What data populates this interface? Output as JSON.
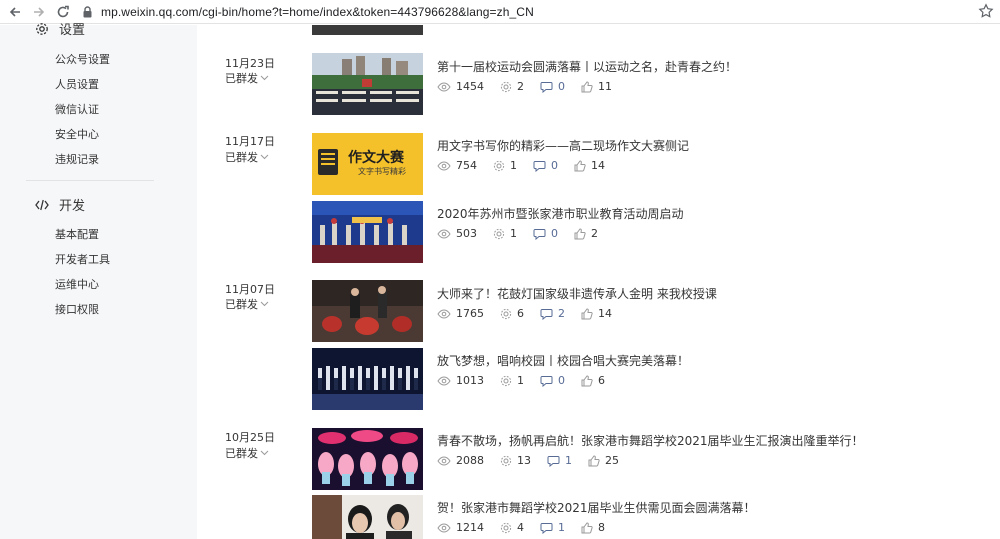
{
  "browser": {
    "url": "mp.weixin.qq.com/cgi-bin/home?t=home/index&token=443796628&lang=zh_CN"
  },
  "sidebar": {
    "settings": {
      "label": "设置",
      "items": [
        "公众号设置",
        "人员设置",
        "微信认证",
        "安全中心",
        "违规记录"
      ]
    },
    "dev": {
      "label": "开发",
      "items": [
        "基本配置",
        "开发者工具",
        "运维中心",
        "接口权限"
      ]
    }
  },
  "status_label": "已群发",
  "groups": [
    {
      "date": "11月23日",
      "articles": [
        {
          "title": "第十一届校运动会圆满落幕丨以运动之名，赴青春之约！",
          "reads": "1454",
          "shares": "2",
          "comments": "0",
          "likes": "11",
          "thumb": "sports-field"
        }
      ]
    },
    {
      "date": "11月17日",
      "articles": [
        {
          "title": "用文字书写你的精彩——高二现场作文大赛侧记",
          "reads": "754",
          "shares": "1",
          "comments": "0",
          "likes": "14",
          "thumb": "essay-contest",
          "thumb_text": "作文大赛",
          "thumb_sub": "文字书写精彩"
        },
        {
          "title": "2020年苏州市暨张家港市职业教育活动周启动",
          "reads": "503",
          "shares": "1",
          "comments": "0",
          "likes": "2",
          "thumb": "ceremony-stage"
        }
      ]
    },
    {
      "date": "11月07日",
      "articles": [
        {
          "title": "大师来了！花鼓灯国家级非遗传承人金明 来我校授课",
          "reads": "1765",
          "shares": "6",
          "comments": "2",
          "likes": "14",
          "thumb": "drum-class"
        },
        {
          "title": "放飞梦想，唱响校园丨校园合唱大赛完美落幕！",
          "reads": "1013",
          "shares": "1",
          "comments": "0",
          "likes": "6",
          "thumb": "choir-stage"
        }
      ]
    },
    {
      "date": "10月25日",
      "articles": [
        {
          "title": "青春不散场，扬帆再启航！张家港市舞蹈学校2021届毕业生汇报演出隆重举行！",
          "reads": "2088",
          "shares": "13",
          "comments": "1",
          "likes": "25",
          "thumb": "dance-show"
        },
        {
          "title": "贺！张家港市舞蹈学校2021届毕业生供需见面会圆满落幕！",
          "reads": "1214",
          "shares": "4",
          "comments": "1",
          "likes": "8",
          "thumb": "graduates"
        }
      ]
    }
  ],
  "colors": {
    "sidebar_bg": "#f6f7f9",
    "link_blue": "#576b95",
    "text": "#353535"
  }
}
